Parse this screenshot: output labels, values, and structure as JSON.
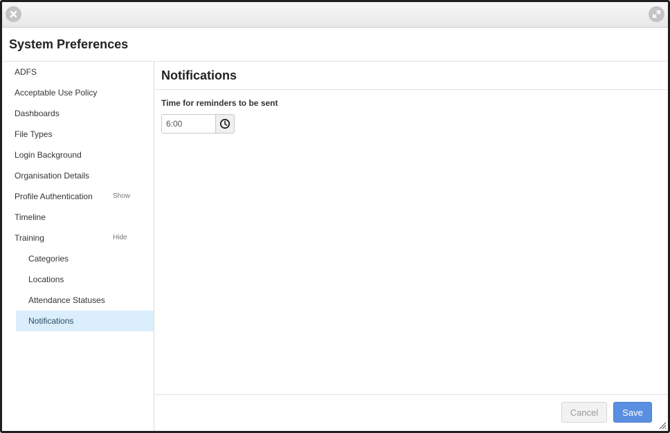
{
  "dialog": {
    "title": "System Preferences"
  },
  "sidebar": {
    "items": [
      {
        "label": "ADFS"
      },
      {
        "label": "Acceptable Use Policy"
      },
      {
        "label": "Dashboards"
      },
      {
        "label": "File Types"
      },
      {
        "label": "Login Background"
      },
      {
        "label": "Organisation Details"
      },
      {
        "label": "Profile Authentication",
        "toggle": "Show"
      },
      {
        "label": "Timeline"
      },
      {
        "label": "Training",
        "toggle": "Hide"
      }
    ],
    "sub_items": [
      {
        "label": "Categories"
      },
      {
        "label": "Locations"
      },
      {
        "label": "Attendance Statuses"
      },
      {
        "label": "Notifications",
        "active": true
      }
    ]
  },
  "content": {
    "title": "Notifications",
    "reminder_label": "Time for reminders to be sent",
    "reminder_time": "6:00"
  },
  "footer": {
    "cancel_label": "Cancel",
    "save_label": "Save"
  },
  "icons": {
    "close": "close-icon",
    "expand": "expand-icon",
    "clock": "clock-icon",
    "resize": "resize-grip-icon"
  },
  "colors": {
    "accent": "#5a8ee0",
    "active_item_bg": "#daeefb"
  }
}
